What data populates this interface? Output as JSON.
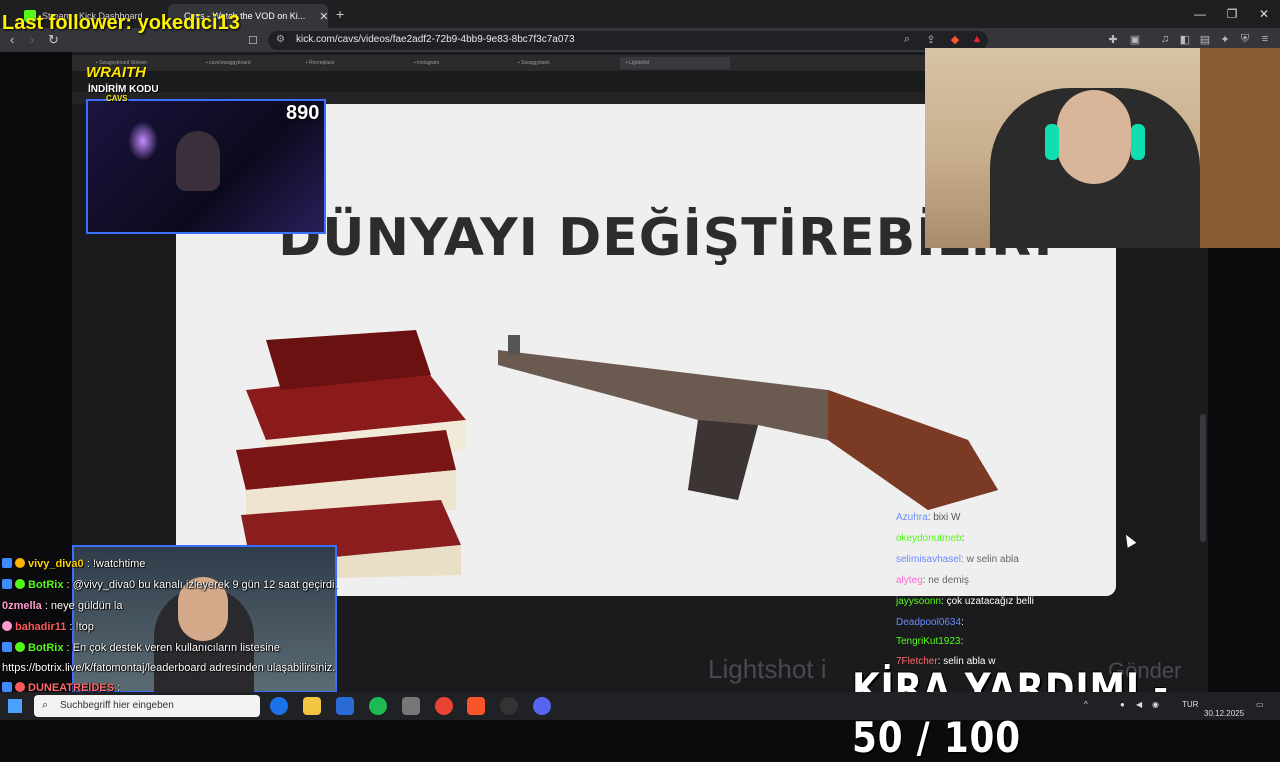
{
  "browser": {
    "tabs": [
      {
        "label": "Stream - Kick Dashboard"
      },
      {
        "label": "Cavs - Watch the VOD on Ki..."
      }
    ],
    "url": "kick.com/cavs/videos/fae2adf2-72b9-4bb9-9e83-8bc7f3c7a073",
    "new_tab_label": "+"
  },
  "stream": {
    "last_follower": "Last follower: yokedici13",
    "brand": "WRAITH",
    "promo": "İNDİRİM KODU",
    "promo_code": "CAVS",
    "viewer_count": "890",
    "slide_title": "DÜNYAYI DEĞİŞTİREBİLİR.",
    "lightshot_text": "Lightshot i",
    "lightshot_tail": "Gönder",
    "kira": "KİRA YARDIMI - 50 / 100"
  },
  "chat": [
    {
      "user": "vivy_diva0",
      "msg": ": !watchtime",
      "color": "#ffd400"
    },
    {
      "user": "BotRix",
      "msg": ": @vivy_diva0 bu kanalı izleyerek 9 gün 12 saat geçirdi.",
      "color": "#53fc18"
    },
    {
      "user": "0zmella",
      "msg": ": neye güldün la",
      "color": "#ff9bd2"
    },
    {
      "user": "bahadir11",
      "msg": ": !top",
      "color": "#ff5a5a"
    },
    {
      "user": "BotRix",
      "msg": ": En çok destek veren kullanıcıların listesine",
      "color": "#53fc18"
    },
    {
      "user": "",
      "msg": "https://botrix.live/k/fatomontaj/leaderboard adresinden ulaşabilirsiniz.",
      "color": "#fff"
    },
    {
      "user": "DUNEATREIDES",
      "msg": ":",
      "color": "#ff6b6b"
    }
  ],
  "right_chat": [
    {
      "user": "Azuhra",
      "msg": ": bixi W",
      "color": "#6a8cff"
    },
    {
      "user": "okeydonutmeb",
      "msg": ":",
      "color": "#53fc18"
    },
    {
      "user": "selimisavhasel",
      "msg": ": w selin abla",
      "color": "#6a8cff"
    },
    {
      "user": "alyteg",
      "msg": ": ne demiş",
      "color": "#ff6bd5"
    },
    {
      "user": "jayysoonn",
      "msg": ": çok uzatacağız belli",
      "color": "#53fc18"
    },
    {
      "user": "Deadpool0634",
      "msg": ":",
      "color": "#6a8cff"
    },
    {
      "user": "TengriKut1923",
      "msg": ":",
      "color": "#53fc18"
    },
    {
      "user": "7Fletcher",
      "msg": ": selin abla w",
      "color": "#ff6b6b"
    }
  ],
  "taskbar": {
    "search_placeholder": "Suchbegriff hier eingeben",
    "lang": "TUR",
    "date": "30.12.2025"
  },
  "colors": {
    "kick_green": "#53fc18",
    "follower_yellow": "#fff200"
  }
}
